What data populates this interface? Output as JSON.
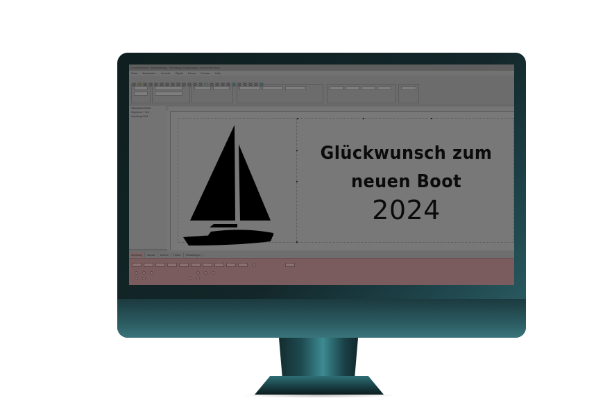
{
  "window": {
    "title": "CorelDesigner / Beschriftung - Schriftzug Glückwunsch zum neuen Boot",
    "menu": [
      "Datei",
      "Bearbeiten",
      "Ansicht",
      "Objekt",
      "Extras",
      "Fenster",
      "Hilfe"
    ]
  },
  "left_panel": {
    "items": [
      "Glückwunschkarte",
      "Segelboot + Text",
      "Schriftzug 2024"
    ]
  },
  "design": {
    "line1": "Glückwunsch zum",
    "line2": "neuen Boot",
    "line3": "2024"
  },
  "tabs": [
    "Schriftzug",
    "Objekte",
    "Ebenen",
    "Farben",
    "Einstellungen"
  ],
  "colors": {
    "monitor_bezel": "#13272a",
    "monitor_accent": "#3d8a92",
    "screen_bg": "#6f6f6f",
    "props_panel": "#7a5c5e"
  }
}
